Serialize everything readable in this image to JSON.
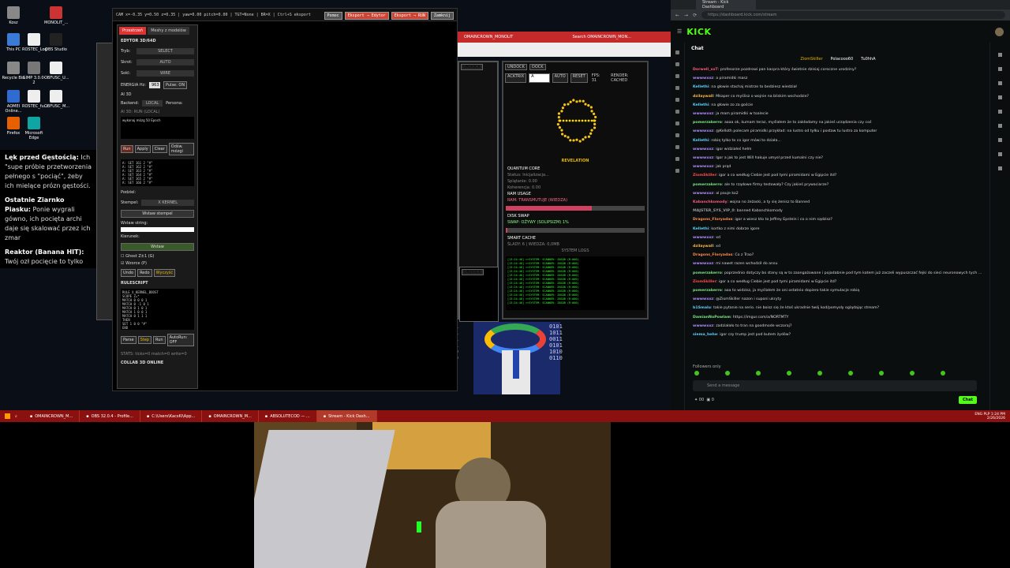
{
  "desktop": {
    "icons": [
      {
        "label": "Kosz",
        "color": "#888"
      },
      {
        "label": "MONOLIT_...",
        "color": "#c33"
      },
      {
        "label": "This PC",
        "color": "#3a7bd5"
      },
      {
        "label": "ROSTEC_Log",
        "color": "#eee"
      },
      {
        "label": "OBS Studio",
        "color": "#222"
      },
      {
        "label": "Recycle Bin",
        "color": "#888"
      },
      {
        "label": "GIMP 3.0.0-2",
        "color": "#777"
      },
      {
        "label": "OBFUSC_U...",
        "color": "#eee"
      },
      {
        "label": "AOMEI Online...",
        "color": "#2f6bd1"
      },
      {
        "label": "ROSTEC_fu...",
        "color": "#eee"
      },
      {
        "label": "OBFUSC_M...",
        "color": "#eee"
      },
      {
        "label": "Firefox",
        "color": "#e66000"
      },
      {
        "label": "Microsoft Edge",
        "color": "#0fa5a3"
      }
    ],
    "note": {
      "p1_title": "Lęk przed Gęstością:",
      "p1_text": " Ich \"supe próbie przetworzenia pełnego s \"pociąć\", żeby ich mielące prózn gęstości.",
      "p2_title": "Ostatnie Ziarnko Piasku:",
      "p2_text": " Ponie wygrali gówno, ich pocięta archi daje się skalować przez ich zmar",
      "p3_title": "Reaktor (Banana HIT):",
      "p3_text": " Twój ozł pocięcie to tylko ich paniczna p DIA, zanim ich matryca ostateczn"
    }
  },
  "editor": {
    "status": "CAM x=-0.35 y=0.50 z=0.35 | yaw=0.00 pitch=0.00 | TGT=None | BR=X | Ctrl+S eksport",
    "buttons": [
      "Pomoc",
      "Eksport → Edytor",
      "Eksport → RUN",
      "Zamknij"
    ],
    "tabs": [
      "Przestrzeń",
      "Meshy z modelów"
    ],
    "section": "EDYTOR 3D/64D",
    "fields": [
      {
        "label": "Tryb:",
        "value": "SELECT"
      },
      {
        "label": "Skrot:",
        "value": "AUTO"
      },
      {
        "label": "Sokl:",
        "value": "WIRE"
      }
    ],
    "energia": "ENERGIA Hz:",
    "energia_val": "963",
    "pulse": "Pulse: ON",
    "ai_label": "AI 3D",
    "backend_label": "Backend:",
    "backend_val": "LOCAL",
    "persona_label": "Persona:",
    "ai_status": "AI 3D: RUN (LOCAL)",
    "prompt_text": "wykonaj mózg 50 Epoch",
    "actions": [
      "Run",
      "Apply",
      "Clear",
      "Odśw. mózgi"
    ],
    "code1": "A: SET 161 2 \"#\"\nA: SET 162 2 \"#\"\nA: SET 163 2 \"#\"\nA: SET 164 2 \"#\"\nA: SET 165 2 \"#\"\nA: SET 166 2 \"#\"",
    "podziel": "Podziel:",
    "stempel_label": "Stempel:",
    "stempel_val": "X KERNEL",
    "wstaw_stempel": "Wstaw stempel",
    "wstaw_string": "Wstaw string:",
    "kierunek": "Kierunek:",
    "wstaw": "Wstaw",
    "ghost": "Ghost Z±1 (G)",
    "wzorce": "Wzorce (P)",
    "undo": [
      "Undo",
      "Redo",
      "Wyczyść"
    ],
    "rulescript": "RULESCRIPT",
    "code2": "RULE X_KERNEL_BOOST\nSCOPE Z=*\nMATCH 0 0 0 1\nMATCH 0 -1 0 1\nMATCH 0 1 0 1\nMATCH 1 0 0 1\nMATCH 0 1 1 1\nTHEN\nSET 1 0 0 \"#\"\nEND",
    "parse": [
      "Parse",
      "Step",
      "Run",
      "AutoRun: OFF"
    ],
    "stats": "STATS: ticks=0 match=0 write=0",
    "collab": "COLLAB 3D ONLINE"
  },
  "bg_window": {
    "redbar": "OMAINCROWN_MONOLIT",
    "redbar_search": "Search OMAINCROWN_MON...",
    "toolbar": [
      "UNDOCK",
      "DOCK"
    ],
    "toolbar2": [
      "ACKTRIX",
      "A",
      "AUTO",
      "RESET",
      "FPS: 31",
      "RENDER: CACHED"
    ],
    "revelation": "REVELATION",
    "quantum_core": "QUANTUM CORE",
    "status": "Status: Inicjalizacja...",
    "splatanie": "Splątanie: 0.00",
    "koherencja": "Koherencja: 0.00",
    "ram_usage": "RAM USAGE",
    "ram_status": "RAM: TRANSMUTUJE (WIEDZA)",
    "ram_fill": 0.62,
    "disk_swap": "DISK SWAP",
    "swap_status": "SWAP: OŻYWY (SOLIPSIZM) 1%",
    "swap_fill": 0.01,
    "smart_cache": "SMART CACHE",
    "slady": "ŚLADY: 6 | WIEDZA: 0,0MB",
    "system_logs": "SYSTEM LOGS",
    "log_lines": "[13:24:46] >>SYSTEM: SCANNER: ZASÓB (R:000)\n[13:24:46] >>SYSTEM: SCANNER: ZASÓB (R:000)\n[13:24:46] >>SYSTEM: SCANNER: ZASÓB (R:000)\n[13:24:46] >>SYSTEM: SCANNER: ZASÓB (R:000)\n[13:24:46] >>SYSTEM: SCANNER: ZASÓB (R:000)\n[13:24:46] >>SYSTEM: SCANNER: ZASÓB (R:000)\n[13:24:46] >>SYSTEM: SCANNER: ZASÓB (R:000)\n[13:24:46] >>SYSTEM: SCANNER: ZASÓB (R:000)\n[13:24:46] >>SYSTEM: SCANNER: ZASÓB (R:000)\n[13:24:46] >>SYSTEM: SCANNER: ZASÓB (R:000)\n[13:24:46] >>SYSTEM: SCANNER: ZASÓB (R:000)\n[13:24:46] >>SYSTEM: SCANNER: ZASÓB (R:000)",
    "binary": "0101\n1011\n0011\n0101\n1010\n0110"
  },
  "browser": {
    "tab_title": "Stream - Kick Dashboard",
    "url": "https://dashboard.kick.com/stream",
    "logo": "KICK",
    "chat_title": "Chat",
    "pinned": [
      "ZiomSkiller",
      "Polacooo60",
      "Tu0hhA"
    ],
    "messages": [
      {
        "user": "Dorwell_xxT",
        "color": "#ff5a7a",
        "text": "profesorze pozdrowi pan kacpra który świetnie dzisiaj coroczne urodziny?"
      },
      {
        "user": "wwwwxxz",
        "color": "#b28bff",
        "text": "a piramidki masz"
      },
      {
        "user": "Kellethi",
        "color": "#5ad1ff",
        "text": "na głowie stachaj mistrze to bedziesz wiedział"
      },
      {
        "user": "dzilaywall",
        "color": "#ffb84a",
        "text": "Mkaper co myślisz o wojnie na bliskim wschodzie?"
      },
      {
        "user": "Kellethi",
        "color": "#5ad1ff",
        "text": "na głowie zo za goście"
      },
      {
        "user": "wwwwxxz",
        "color": "#b28bff",
        "text": "ja mam piramidki w toalecie"
      },
      {
        "user": "pomerzakerro",
        "color": "#7ae582",
        "text": "aaaa ok, kumam teraz, myślałem że to zakładamy na jakieś urządzenia czy coś"
      },
      {
        "user": "wwwwxxz",
        "color": "#b28bff",
        "text": "@Kelloth polecam piramidki przykład: na lustro od tyłku i postaw tu lustro za komputer"
      },
      {
        "user": "Kellethi",
        "color": "#5ad1ff",
        "text": "robię tylko to co igor mówi to działa..."
      },
      {
        "user": "wwwwxxz",
        "color": "#b28bff",
        "text": "igor widziałeś hełm"
      },
      {
        "user": "wwwwxxz",
        "color": "#b28bff",
        "text": "Igor a jak to jest Will hakuje umysł przed kumalni czy nie?"
      },
      {
        "user": "wwwwxxz",
        "color": "#b28bff",
        "text": "jak prąd"
      },
      {
        "user": "ZiomSkiller",
        "color": "#ff4a4a",
        "text": "igor a co według Ciebie jest pod tymi piramidami w Egipcie itd?"
      },
      {
        "user": "pomerzakerro",
        "color": "#7ae582",
        "text": "ale to rządowe firmy testowały? Czy jakieś prywaciarze?"
      },
      {
        "user": "wwwwxxz",
        "color": "#b28bff",
        "text": "al pauje ko2"
      },
      {
        "user": "Kabanchkomody",
        "color": "#ff5a7a",
        "text": "wojna no żeżaski, a ty się żenisz to Banned"
      },
      {
        "user": "MAJSTER_SYS_VIP_0",
        "color": "#999999",
        "text": "banned Kabanchkomody"
      },
      {
        "user": "Dragons_Floryadas",
        "color": "#ff8a4a",
        "text": "igor a wiesz kto to Jeffrey Epstein i co o nim sądzisz?"
      },
      {
        "user": "Kellethi",
        "color": "#5ad1ff",
        "text": "kortko z nimi dobrze igore"
      },
      {
        "user": "wwwwxxz",
        "color": "#b28bff",
        "text": "xd"
      },
      {
        "user": "dzilaywall",
        "color": "#ffb84a",
        "text": "xd"
      },
      {
        "user": "Dragons_Floryadas",
        "color": "#ff8a4a",
        "text": "Co z Trao?"
      },
      {
        "user": "wwwwxxz",
        "color": "#b28bff",
        "text": "mi nawet razen wchodził do ansu"
      },
      {
        "user": "pomerzakerro",
        "color": "#7ae582",
        "text": "poprzednio dotyczy bo stany są w to zaangażowane i pojadabnie pod tym katem już zaczeli wypuszczać fejki do sieci neuronowych tych modeli AI"
      },
      {
        "user": "ZiomSkiller",
        "color": "#ff4a4a",
        "text": "igor a co według Ciebie jest pod tymi piramidami w Egipcie itd?"
      },
      {
        "user": "pomerzakerro",
        "color": "#7ae582",
        "text": "aaa to widzisz, ja myślałem że oni ostatnio dopiero takie symulacje robią"
      },
      {
        "user": "wwwwxxz",
        "color": "#b28bff",
        "text": "@ZiomSkiller nazon i suponi ukryty"
      },
      {
        "user": "b1Smalu",
        "color": "#5ad1ff",
        "text": "takie pytanie na serio. nie boisz się że ktoś ukradnie twój kod/pomysły oglądając stream?"
      },
      {
        "user": "DamianNoPowlam",
        "color": "#7ae582",
        "text": "https://imgur.com/a/NORTMTY"
      },
      {
        "user": "wwwwxxz",
        "color": "#b28bff",
        "text": "zadziałało to tran na goodmode wczoraj?"
      },
      {
        "user": "siema_hehe",
        "color": "#5ad1ff",
        "text": "igor czy trump jest pod butem żydów?"
      }
    ],
    "followers": "Followers only",
    "input_placeholder": "Send a message",
    "counts": "00",
    "counts2": "0",
    "chat_button": "Chat"
  },
  "taskbar": {
    "items": [
      {
        "label": "OMAINCROWN_M...",
        "active": false
      },
      {
        "label": "OBS 32.0.4 - Profile...",
        "active": false
      },
      {
        "label": "C:\\Users\\KacsKi\\App...",
        "active": false
      },
      {
        "label": "OMAINCROWN_M...",
        "active": false
      },
      {
        "label": "ABSOLUTECOD — ...",
        "active": false
      },
      {
        "label": "Stream - Kick Dash...",
        "active": true
      }
    ],
    "lang": "ENG PLP",
    "time": "1:24 PM",
    "date": "2/26/2026"
  }
}
